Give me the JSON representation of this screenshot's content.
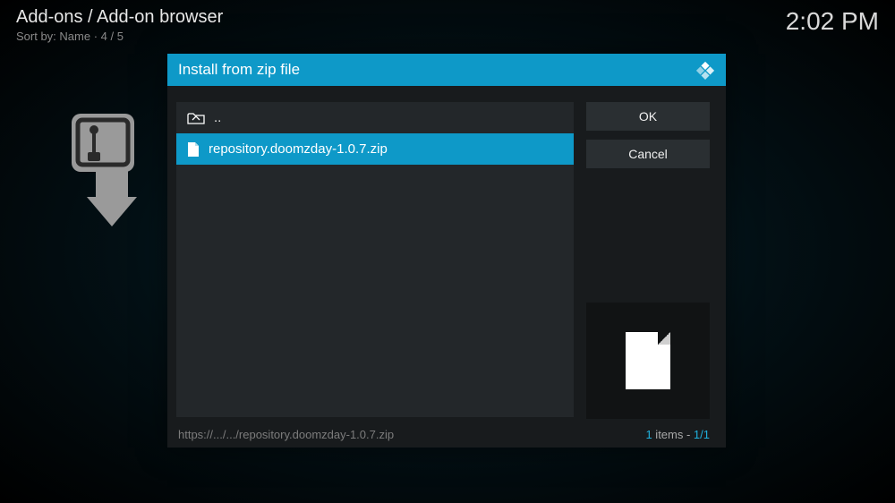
{
  "header": {
    "breadcrumb": "Add-ons / Add-on browser",
    "sort_prefix": "Sort by: ",
    "sort_value": "Name",
    "page_sep": "  ·  ",
    "page_pos": "4 / 5",
    "clock": "2:02 PM"
  },
  "dialog": {
    "title": "Install from zip file",
    "parent_label": "..",
    "selected_file": "repository.doomzday-1.0.7.zip",
    "ok_label": "OK",
    "cancel_label": "Cancel",
    "path": "https://.../.../repository.doomzday-1.0.7.zip",
    "count_num": "1",
    "count_word": " items - ",
    "count_page": "1/1"
  },
  "colors": {
    "accent": "#0e99c8"
  }
}
